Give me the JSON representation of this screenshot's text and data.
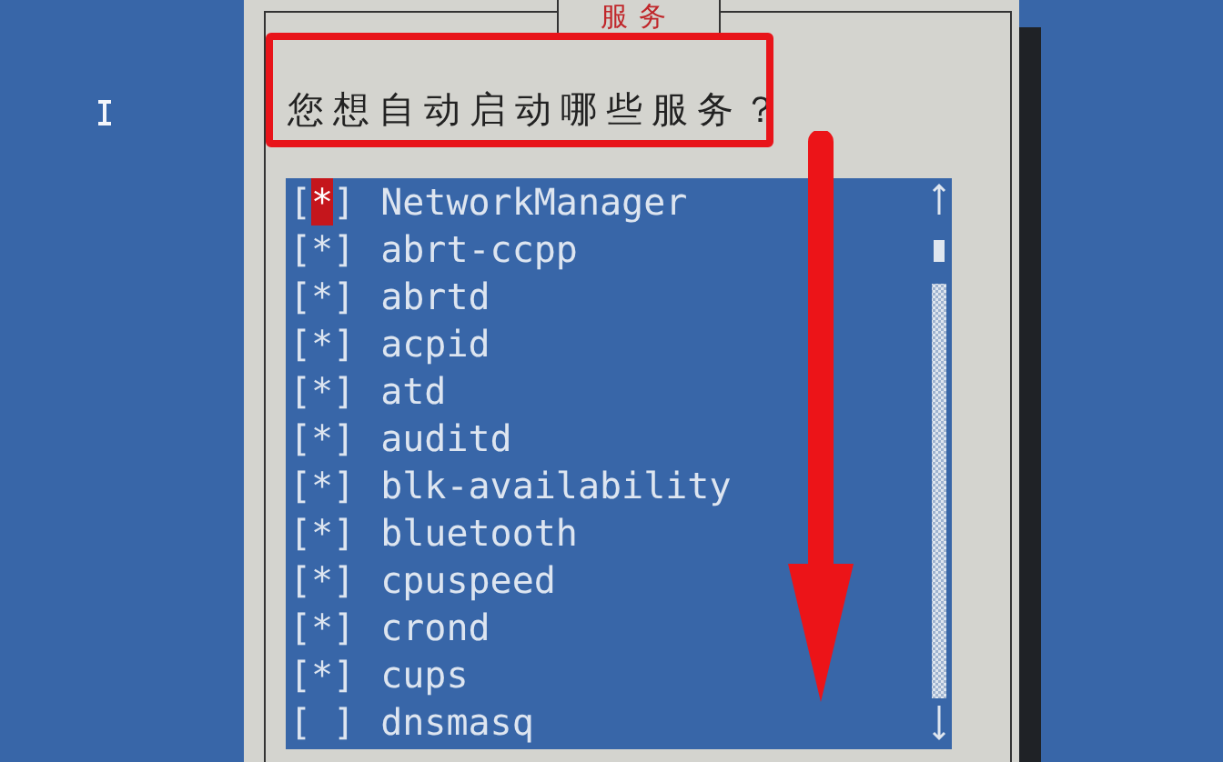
{
  "dialog": {
    "title": "服务",
    "question": "您想自动启动哪些服务？"
  },
  "check": {
    "open": "[",
    "close": "]",
    "mark": "*"
  },
  "services": [
    {
      "label": "NetworkManager",
      "checked": true,
      "selected": true
    },
    {
      "label": "abrt-ccpp",
      "checked": true,
      "selected": false
    },
    {
      "label": "abrtd",
      "checked": true,
      "selected": false
    },
    {
      "label": "acpid",
      "checked": true,
      "selected": false
    },
    {
      "label": "atd",
      "checked": true,
      "selected": false
    },
    {
      "label": "auditd",
      "checked": true,
      "selected": false
    },
    {
      "label": "blk-availability",
      "checked": true,
      "selected": false
    },
    {
      "label": "bluetooth",
      "checked": true,
      "selected": false
    },
    {
      "label": "cpuspeed",
      "checked": true,
      "selected": false
    },
    {
      "label": "crond",
      "checked": true,
      "selected": false
    },
    {
      "label": "cups",
      "checked": true,
      "selected": false
    },
    {
      "label": "dnsmasq",
      "checked": false,
      "selected": false
    }
  ]
}
